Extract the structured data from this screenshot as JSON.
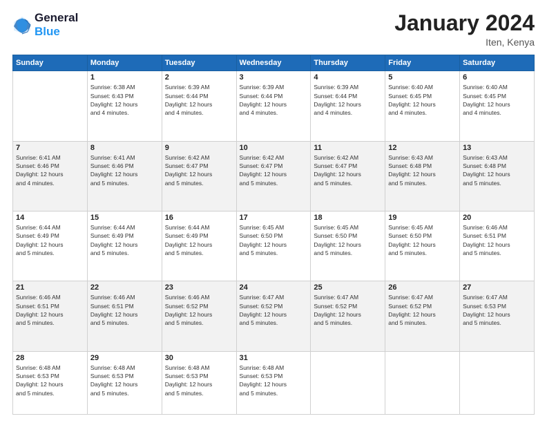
{
  "logo": {
    "line1": "General",
    "line2": "Blue"
  },
  "title": "January 2024",
  "subtitle": "Iten, Kenya",
  "days_of_week": [
    "Sunday",
    "Monday",
    "Tuesday",
    "Wednesday",
    "Thursday",
    "Friday",
    "Saturday"
  ],
  "weeks": [
    [
      {
        "day": "",
        "info": ""
      },
      {
        "day": "1",
        "info": "Sunrise: 6:38 AM\nSunset: 6:43 PM\nDaylight: 12 hours\nand 4 minutes."
      },
      {
        "day": "2",
        "info": "Sunrise: 6:39 AM\nSunset: 6:44 PM\nDaylight: 12 hours\nand 4 minutes."
      },
      {
        "day": "3",
        "info": "Sunrise: 6:39 AM\nSunset: 6:44 PM\nDaylight: 12 hours\nand 4 minutes."
      },
      {
        "day": "4",
        "info": "Sunrise: 6:39 AM\nSunset: 6:44 PM\nDaylight: 12 hours\nand 4 minutes."
      },
      {
        "day": "5",
        "info": "Sunrise: 6:40 AM\nSunset: 6:45 PM\nDaylight: 12 hours\nand 4 minutes."
      },
      {
        "day": "6",
        "info": "Sunrise: 6:40 AM\nSunset: 6:45 PM\nDaylight: 12 hours\nand 4 minutes."
      }
    ],
    [
      {
        "day": "7",
        "info": "Sunrise: 6:41 AM\nSunset: 6:46 PM\nDaylight: 12 hours\nand 4 minutes."
      },
      {
        "day": "8",
        "info": "Sunrise: 6:41 AM\nSunset: 6:46 PM\nDaylight: 12 hours\nand 5 minutes."
      },
      {
        "day": "9",
        "info": "Sunrise: 6:42 AM\nSunset: 6:47 PM\nDaylight: 12 hours\nand 5 minutes."
      },
      {
        "day": "10",
        "info": "Sunrise: 6:42 AM\nSunset: 6:47 PM\nDaylight: 12 hours\nand 5 minutes."
      },
      {
        "day": "11",
        "info": "Sunrise: 6:42 AM\nSunset: 6:47 PM\nDaylight: 12 hours\nand 5 minutes."
      },
      {
        "day": "12",
        "info": "Sunrise: 6:43 AM\nSunset: 6:48 PM\nDaylight: 12 hours\nand 5 minutes."
      },
      {
        "day": "13",
        "info": "Sunrise: 6:43 AM\nSunset: 6:48 PM\nDaylight: 12 hours\nand 5 minutes."
      }
    ],
    [
      {
        "day": "14",
        "info": "Sunrise: 6:44 AM\nSunset: 6:49 PM\nDaylight: 12 hours\nand 5 minutes."
      },
      {
        "day": "15",
        "info": "Sunrise: 6:44 AM\nSunset: 6:49 PM\nDaylight: 12 hours\nand 5 minutes."
      },
      {
        "day": "16",
        "info": "Sunrise: 6:44 AM\nSunset: 6:49 PM\nDaylight: 12 hours\nand 5 minutes."
      },
      {
        "day": "17",
        "info": "Sunrise: 6:45 AM\nSunset: 6:50 PM\nDaylight: 12 hours\nand 5 minutes."
      },
      {
        "day": "18",
        "info": "Sunrise: 6:45 AM\nSunset: 6:50 PM\nDaylight: 12 hours\nand 5 minutes."
      },
      {
        "day": "19",
        "info": "Sunrise: 6:45 AM\nSunset: 6:50 PM\nDaylight: 12 hours\nand 5 minutes."
      },
      {
        "day": "20",
        "info": "Sunrise: 6:46 AM\nSunset: 6:51 PM\nDaylight: 12 hours\nand 5 minutes."
      }
    ],
    [
      {
        "day": "21",
        "info": "Sunrise: 6:46 AM\nSunset: 6:51 PM\nDaylight: 12 hours\nand 5 minutes."
      },
      {
        "day": "22",
        "info": "Sunrise: 6:46 AM\nSunset: 6:51 PM\nDaylight: 12 hours\nand 5 minutes."
      },
      {
        "day": "23",
        "info": "Sunrise: 6:46 AM\nSunset: 6:52 PM\nDaylight: 12 hours\nand 5 minutes."
      },
      {
        "day": "24",
        "info": "Sunrise: 6:47 AM\nSunset: 6:52 PM\nDaylight: 12 hours\nand 5 minutes."
      },
      {
        "day": "25",
        "info": "Sunrise: 6:47 AM\nSunset: 6:52 PM\nDaylight: 12 hours\nand 5 minutes."
      },
      {
        "day": "26",
        "info": "Sunrise: 6:47 AM\nSunset: 6:52 PM\nDaylight: 12 hours\nand 5 minutes."
      },
      {
        "day": "27",
        "info": "Sunrise: 6:47 AM\nSunset: 6:53 PM\nDaylight: 12 hours\nand 5 minutes."
      }
    ],
    [
      {
        "day": "28",
        "info": "Sunrise: 6:48 AM\nSunset: 6:53 PM\nDaylight: 12 hours\nand 5 minutes."
      },
      {
        "day": "29",
        "info": "Sunrise: 6:48 AM\nSunset: 6:53 PM\nDaylight: 12 hours\nand 5 minutes."
      },
      {
        "day": "30",
        "info": "Sunrise: 6:48 AM\nSunset: 6:53 PM\nDaylight: 12 hours\nand 5 minutes."
      },
      {
        "day": "31",
        "info": "Sunrise: 6:48 AM\nSunset: 6:53 PM\nDaylight: 12 hours\nand 5 minutes."
      },
      {
        "day": "",
        "info": ""
      },
      {
        "day": "",
        "info": ""
      },
      {
        "day": "",
        "info": ""
      }
    ]
  ]
}
